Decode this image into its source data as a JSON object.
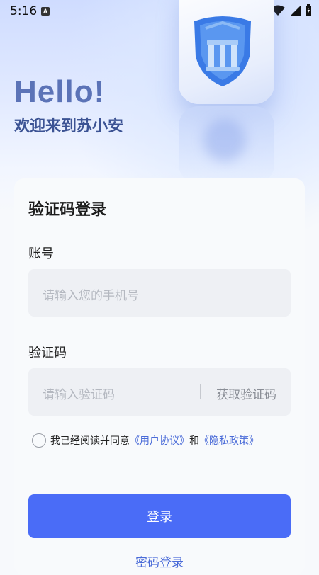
{
  "status_bar": {
    "time": "5:16",
    "notification_letter": "A"
  },
  "header": {
    "greeting": "Hello!",
    "welcome": "欢迎来到苏小安"
  },
  "login_card": {
    "title": "验证码登录",
    "account_label": "账号",
    "account_placeholder": "请输入您的手机号",
    "code_label": "验证码",
    "code_placeholder": "请输入验证码",
    "get_code_label": "获取验证码",
    "agree_text": "我已经阅读并同意",
    "user_agreement": "《用户协议》",
    "and_text": "和",
    "privacy_policy": "《隐私政策》",
    "login_button": "登录",
    "password_login": "密码登录"
  },
  "colors": {
    "accent": "#4a6cf7",
    "link": "#4a6bd8",
    "greeting": "#5b73b7"
  }
}
